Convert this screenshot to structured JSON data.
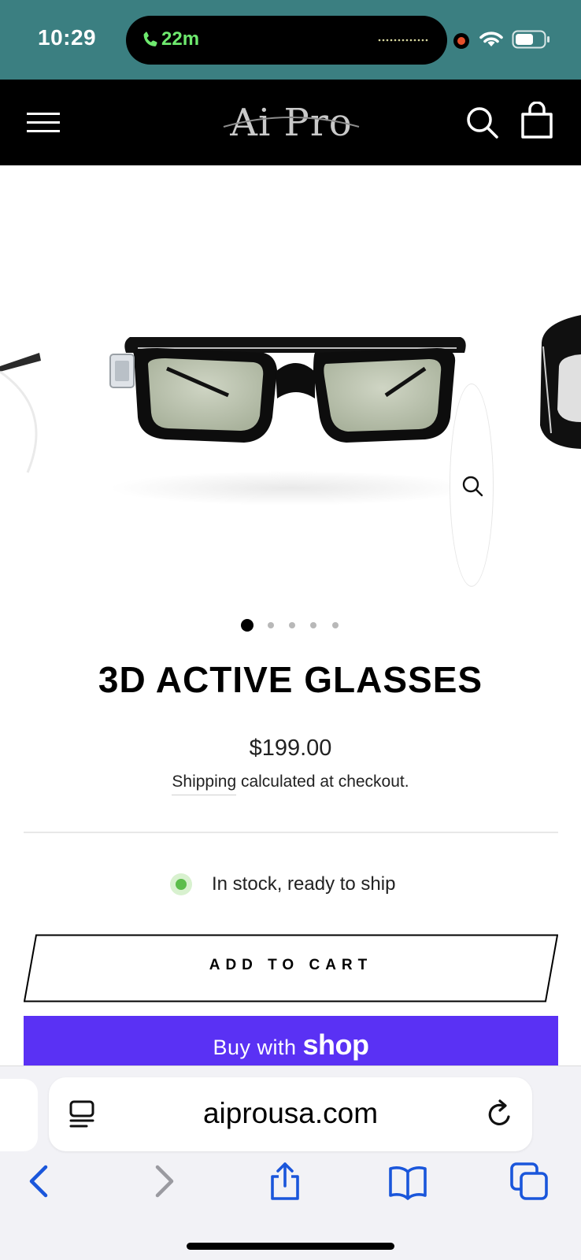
{
  "status_bar": {
    "time": "10:29",
    "call_duration": "22m",
    "colors": {
      "background": "#3b7f81",
      "call_green": "#6ee96e",
      "recording_dot": "#e5502b"
    },
    "icons": [
      "phone-icon",
      "waveform-icon",
      "recording-indicator",
      "wifi-icon",
      "battery-icon"
    ]
  },
  "header": {
    "logo_text": "Ai Pro",
    "icons": [
      "menu-icon",
      "search-icon",
      "cart-icon"
    ],
    "background": "#000000"
  },
  "gallery": {
    "image_alt": "3D active glasses product photo",
    "icons": [
      "zoom-icon"
    ],
    "dots_count": 5,
    "active_dot": 1
  },
  "product": {
    "title": "3D ACTIVE GLASSES",
    "price": "$199.00",
    "shipping_link": "Shipping",
    "shipping_rest": " calculated at checkout.",
    "stock_text": "In stock, ready to ship",
    "stock_color": "#5cbd4b"
  },
  "buttons": {
    "add_to_cart": "ADD TO CART",
    "buy_with": "Buy with",
    "shop_word": "shop",
    "shop_color": "#5a31f4"
  },
  "browser": {
    "url": "aiprousa.com",
    "icons": [
      "reader-icon",
      "reload-icon",
      "back-icon",
      "forward-icon",
      "share-icon",
      "bookmarks-icon",
      "tabs-icon"
    ],
    "accent": "#1a56db"
  }
}
